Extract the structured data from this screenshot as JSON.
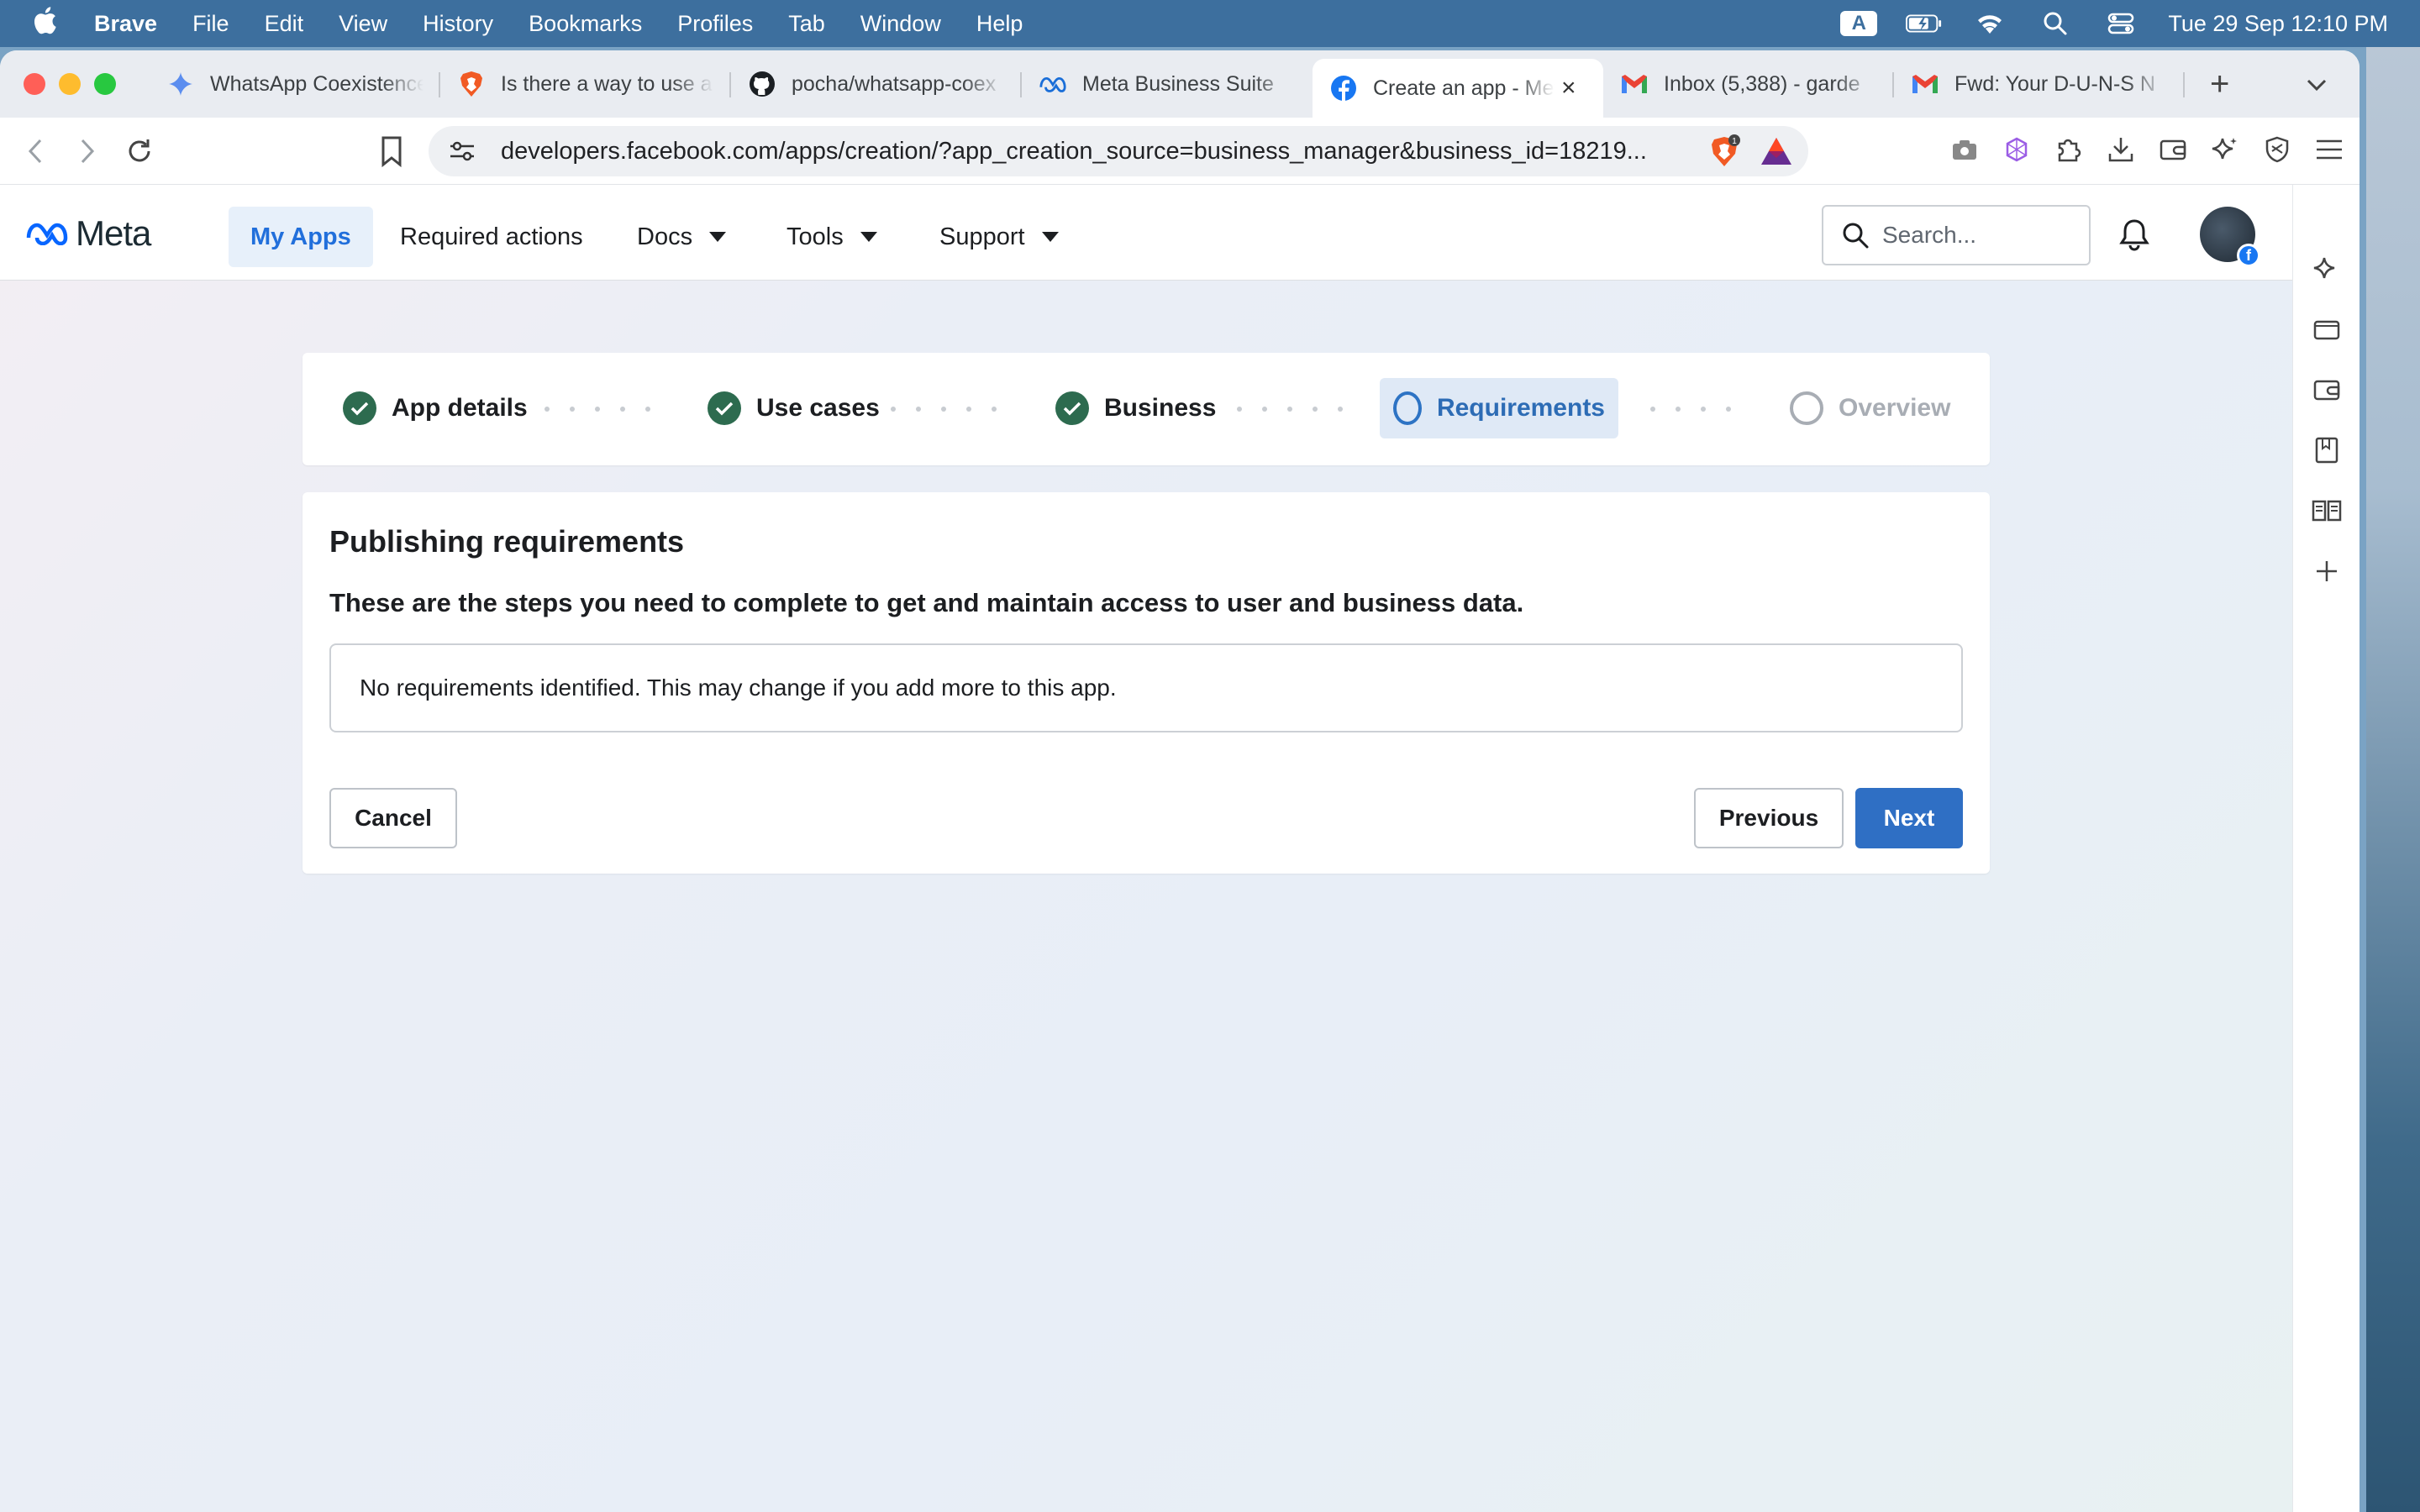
{
  "menubar": {
    "app": "Brave",
    "items": [
      "File",
      "Edit",
      "View",
      "History",
      "Bookmarks",
      "Profiles",
      "Tab",
      "Window",
      "Help"
    ],
    "input_source": "A",
    "datetime": "Tue 29 Sep  12:10 PM"
  },
  "tabs": [
    {
      "title": "WhatsApp Coexistence",
      "icon": "gemini-icon"
    },
    {
      "title": "Is there a way to use a",
      "icon": "brave-icon"
    },
    {
      "title": "pocha/whatsapp-coex",
      "icon": "github-icon"
    },
    {
      "title": "Meta Business Suite",
      "icon": "meta-icon"
    },
    {
      "title": "Create an app - Meta",
      "icon": "facebook-icon",
      "active": true
    },
    {
      "title": "Inbox (5,388) - garde",
      "icon": "gmail-icon"
    },
    {
      "title": "Fwd: Your D-U-N-S N",
      "icon": "gmail-icon"
    }
  ],
  "toolbar": {
    "url": "developers.facebook.com/apps/creation/?app_creation_source=business_manager&business_id=18219...",
    "shield_count": "1"
  },
  "metanav": {
    "logo": "Meta",
    "items": [
      {
        "label": "My Apps",
        "active": true
      },
      {
        "label": "Required actions"
      },
      {
        "label": "Docs",
        "dropdown": true
      },
      {
        "label": "Tools",
        "dropdown": true
      },
      {
        "label": "Support",
        "dropdown": true
      }
    ],
    "search_placeholder": "Search..."
  },
  "stepper": {
    "steps": [
      {
        "label": "App details",
        "state": "done"
      },
      {
        "label": "Use cases",
        "state": "done"
      },
      {
        "label": "Business",
        "state": "done"
      },
      {
        "label": "Requirements",
        "state": "current"
      },
      {
        "label": "Overview",
        "state": "future"
      }
    ]
  },
  "card": {
    "title": "Publishing requirements",
    "subtitle": "These are the steps you need to complete to get and maintain access to user and business data.",
    "notice": "No requirements identified. This may change if you add more to this app.",
    "cancel": "Cancel",
    "previous": "Previous",
    "next": "Next"
  },
  "colors": {
    "accent": "#2f6fc4",
    "done": "#2d6b4f",
    "menubar": "#3d6f9e"
  }
}
